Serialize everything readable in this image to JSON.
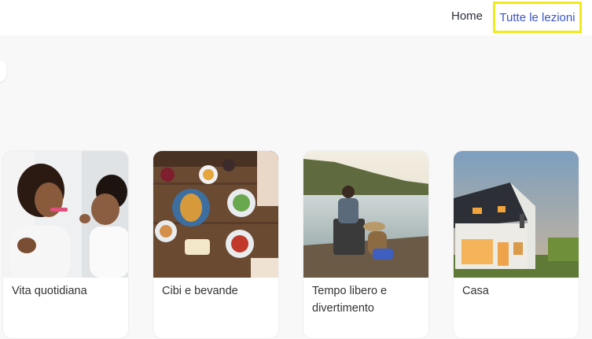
{
  "nav": {
    "home_label": "Home",
    "all_lessons_label": "Tutte le lezioni"
  },
  "categories": [
    {
      "label": "Vita quotidiana"
    },
    {
      "label": "Cibi e bevande"
    },
    {
      "label": "Tempo libero e divertimento"
    },
    {
      "label": "Casa"
    }
  ],
  "colors": {
    "nav_accent": "#3a55c9",
    "highlight_border": "#f2ea1c",
    "page_background": "#f8f8f8"
  }
}
